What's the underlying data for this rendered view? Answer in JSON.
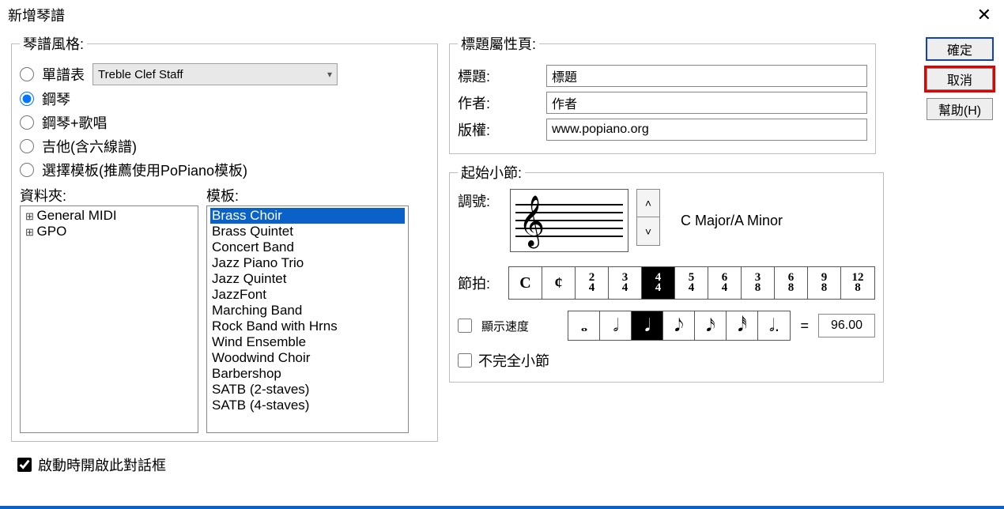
{
  "window": {
    "title": "新增琴譜"
  },
  "style_group": {
    "legend": "琴譜風格:",
    "radios": {
      "single": "單譜表",
      "piano": "鋼琴",
      "piano_vocal": "鋼琴+歌唱",
      "guitar": "吉他(含六線譜)",
      "template": "選擇模板(推薦使用PoPiano模板)"
    },
    "combo_value": "Treble Clef Staff",
    "folder_label": "資料夾:",
    "template_label": "模板:",
    "folders": [
      "General MIDI",
      "GPO"
    ],
    "templates": [
      "Brass Choir",
      "Brass Quintet",
      "Concert Band",
      "Jazz Piano Trio",
      "Jazz Quintet",
      "JazzFont",
      "Marching Band",
      "Rock Band with Hrns",
      "Wind Ensemble",
      "Woodwind Choir",
      "Barbershop",
      "SATB (2-staves)",
      "SATB (4-staves)"
    ],
    "template_selected": 0
  },
  "props": {
    "legend": "標題屬性頁:",
    "title_label": "標題:",
    "title_value": "標題",
    "author_label": "作者:",
    "author_value": "作者",
    "copyright_label": "版權:",
    "copyright_value": "www.popiano.org"
  },
  "measure": {
    "legend": "起始小節:",
    "keysig_label": "調號:",
    "keysig_name": "C Major/A Minor",
    "timesig_label": "節拍:",
    "timesigs": [
      "C",
      "¢",
      "2/4",
      "3/4",
      "4/4",
      "5/4",
      "6/4",
      "3/8",
      "6/8",
      "9/8",
      "12/8"
    ],
    "timesig_selected": 4,
    "show_tempo_label": "顯示速度",
    "notes": [
      "𝅝",
      "𝅗𝅥",
      "𝅘𝅥",
      "𝅘𝅥𝅮",
      "𝅘𝅥𝅯",
      "𝅘𝅥𝅰",
      "𝅗𝅥."
    ],
    "note_selected": 2,
    "tempo_value": "96.00",
    "pickup_label": "不完全小節"
  },
  "buttons": {
    "ok": "確定",
    "cancel": "取消",
    "help": "幫助(H)"
  },
  "footer": {
    "startup_label": "啟動時開啟此對話框"
  }
}
